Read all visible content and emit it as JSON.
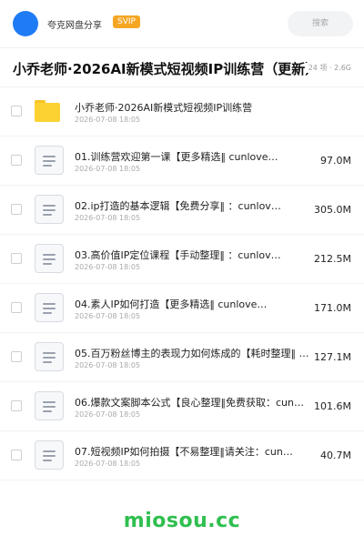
{
  "header": {
    "username": "夸克网盘分享",
    "badge": "SVIP",
    "search_placeholder": "搜索",
    "avatar_color": "#1f7cf5",
    "badge_color": "#f5a623"
  },
  "folder": {
    "title": "小乔老师·2026AI新模式短视频IP训练营（更新）",
    "meta": "24 项 · 2.6G"
  },
  "items": [
    {
      "type": "folder-icon",
      "name": "小乔老师·2026AI新模式短视频IP训练营",
      "date": "2026-07-08 18:05",
      "size": ""
    },
    {
      "type": "file-icon",
      "name": "01.训练营欢迎第一课【更多精选‖ cunlove…",
      "date": "2026-07-08 18:05",
      "size": "97.0M"
    },
    {
      "type": "file-icon",
      "name": "02.ip打造的基本逻辑【免费分享‖ ：cunlov…",
      "date": "2026-07-08 18:05",
      "size": "305.0M"
    },
    {
      "type": "file-icon",
      "name": "03.高价值IP定位课程【手动整理‖ ：cunlov…",
      "date": "2026-07-08 18:05",
      "size": "212.5M"
    },
    {
      "type": "file-icon",
      "name": "04.素人IP如何打造【更多精选‖ cunlove…",
      "date": "2026-07-08 18:05",
      "size": "171.0M"
    },
    {
      "type": "file-icon",
      "name": "05.百万粉丝博主的表现力如何炼成的【耗时整理‖ 不…",
      "date": "2026-07-08 18:05",
      "size": "127.1M"
    },
    {
      "type": "file-icon",
      "name": "06.爆款文案脚本公式【良心整理‖免费获取：cun…",
      "date": "2026-07-08 18:05",
      "size": "101.6M"
    },
    {
      "type": "file-icon",
      "name": "07.短视频IP如何拍摄【不易整理‖请关注：cun…",
      "date": "2026-07-08 18:05",
      "size": "40.7M"
    }
  ],
  "watermark": "miosou.cc",
  "watermark_color": "#2fbf4f"
}
